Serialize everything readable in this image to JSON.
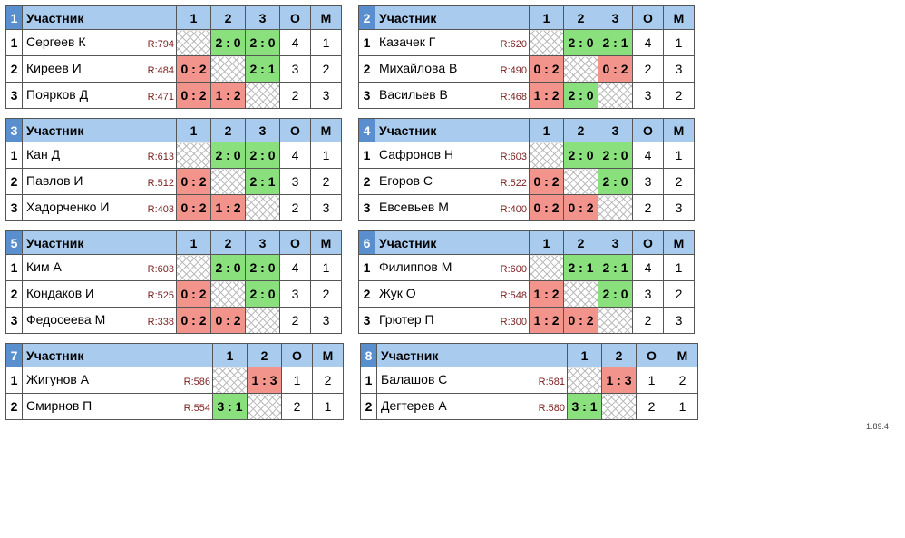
{
  "labels": {
    "participant": "Участник",
    "O": "О",
    "M": "М"
  },
  "footer": "1.89.4",
  "groups": [
    {
      "num": 1,
      "size": 3,
      "players": [
        {
          "n": 1,
          "name": "Сергеев К",
          "rating": "R:794",
          "cells": [
            {
              "t": "diag"
            },
            {
              "t": "win",
              "s": "2 : 0"
            },
            {
              "t": "win",
              "s": "2 : 0"
            }
          ],
          "O": "4",
          "M": "1"
        },
        {
          "n": 2,
          "name": "Киреев И",
          "rating": "R:484",
          "cells": [
            {
              "t": "lose",
              "s": "0 : 2"
            },
            {
              "t": "diag"
            },
            {
              "t": "win",
              "s": "2 : 1"
            }
          ],
          "O": "3",
          "M": "2"
        },
        {
          "n": 3,
          "name": "Поярков Д",
          "rating": "R:471",
          "cells": [
            {
              "t": "lose",
              "s": "0 : 2"
            },
            {
              "t": "lose",
              "s": "1 : 2"
            },
            {
              "t": "diag"
            }
          ],
          "O": "2",
          "M": "3"
        }
      ]
    },
    {
      "num": 2,
      "size": 3,
      "players": [
        {
          "n": 1,
          "name": "Казачек Г",
          "rating": "R:620",
          "cells": [
            {
              "t": "diag"
            },
            {
              "t": "win",
              "s": "2 : 0"
            },
            {
              "t": "win",
              "s": "2 : 1"
            }
          ],
          "O": "4",
          "M": "1"
        },
        {
          "n": 2,
          "name": "Михайлова В",
          "rating": "R:490",
          "cells": [
            {
              "t": "lose",
              "s": "0 : 2"
            },
            {
              "t": "diag"
            },
            {
              "t": "lose",
              "s": "0 : 2"
            }
          ],
          "O": "2",
          "M": "3"
        },
        {
          "n": 3,
          "name": "Васильев В",
          "rating": "R:468",
          "cells": [
            {
              "t": "lose",
              "s": "1 : 2"
            },
            {
              "t": "win",
              "s": "2 : 0"
            },
            {
              "t": "diag"
            }
          ],
          "O": "3",
          "M": "2"
        }
      ]
    },
    {
      "num": 3,
      "size": 3,
      "players": [
        {
          "n": 1,
          "name": "Кан Д",
          "rating": "R:613",
          "cells": [
            {
              "t": "diag"
            },
            {
              "t": "win",
              "s": "2 : 0"
            },
            {
              "t": "win",
              "s": "2 : 0"
            }
          ],
          "O": "4",
          "M": "1"
        },
        {
          "n": 2,
          "name": "Павлов И",
          "rating": "R:512",
          "cells": [
            {
              "t": "lose",
              "s": "0 : 2"
            },
            {
              "t": "diag"
            },
            {
              "t": "win",
              "s": "2 : 1"
            }
          ],
          "O": "3",
          "M": "2"
        },
        {
          "n": 3,
          "name": "Хадорченко И",
          "rating": "R:403",
          "cells": [
            {
              "t": "lose",
              "s": "0 : 2"
            },
            {
              "t": "lose",
              "s": "1 : 2"
            },
            {
              "t": "diag"
            }
          ],
          "O": "2",
          "M": "3"
        }
      ]
    },
    {
      "num": 4,
      "size": 3,
      "players": [
        {
          "n": 1,
          "name": "Сафронов Н",
          "rating": "R:603",
          "cells": [
            {
              "t": "diag"
            },
            {
              "t": "win",
              "s": "2 : 0"
            },
            {
              "t": "win",
              "s": "2 : 0"
            }
          ],
          "O": "4",
          "M": "1"
        },
        {
          "n": 2,
          "name": "Егоров С",
          "rating": "R:522",
          "cells": [
            {
              "t": "lose",
              "s": "0 : 2"
            },
            {
              "t": "diag"
            },
            {
              "t": "win",
              "s": "2 : 0"
            }
          ],
          "O": "3",
          "M": "2"
        },
        {
          "n": 3,
          "name": "Евсевьев М",
          "rating": "R:400",
          "cells": [
            {
              "t": "lose",
              "s": "0 : 2"
            },
            {
              "t": "lose",
              "s": "0 : 2"
            },
            {
              "t": "diag"
            }
          ],
          "O": "2",
          "M": "3"
        }
      ]
    },
    {
      "num": 5,
      "size": 3,
      "players": [
        {
          "n": 1,
          "name": "Ким А",
          "rating": "R:603",
          "cells": [
            {
              "t": "diag"
            },
            {
              "t": "win",
              "s": "2 : 0"
            },
            {
              "t": "win",
              "s": "2 : 0"
            }
          ],
          "O": "4",
          "M": "1"
        },
        {
          "n": 2,
          "name": "Кондаков И",
          "rating": "R:525",
          "cells": [
            {
              "t": "lose",
              "s": "0 : 2"
            },
            {
              "t": "diag"
            },
            {
              "t": "win",
              "s": "2 : 0"
            }
          ],
          "O": "3",
          "M": "2"
        },
        {
          "n": 3,
          "name": "Федосеева М",
          "rating": "R:338",
          "cells": [
            {
              "t": "lose",
              "s": "0 : 2"
            },
            {
              "t": "lose",
              "s": "0 : 2"
            },
            {
              "t": "diag"
            }
          ],
          "O": "2",
          "M": "3"
        }
      ]
    },
    {
      "num": 6,
      "size": 3,
      "players": [
        {
          "n": 1,
          "name": "Филиппов М",
          "rating": "R:600",
          "cells": [
            {
              "t": "diag"
            },
            {
              "t": "win",
              "s": "2 : 1"
            },
            {
              "t": "win",
              "s": "2 : 1"
            }
          ],
          "O": "4",
          "M": "1"
        },
        {
          "n": 2,
          "name": "Жук О",
          "rating": "R:548",
          "cells": [
            {
              "t": "lose",
              "s": "1 : 2"
            },
            {
              "t": "diag"
            },
            {
              "t": "win",
              "s": "2 : 0"
            }
          ],
          "O": "3",
          "M": "2"
        },
        {
          "n": 3,
          "name": "Грютер П",
          "rating": "R:300",
          "cells": [
            {
              "t": "lose",
              "s": "1 : 2"
            },
            {
              "t": "lose",
              "s": "0 : 2"
            },
            {
              "t": "diag"
            }
          ],
          "O": "2",
          "M": "3"
        }
      ]
    },
    {
      "num": 7,
      "size": 2,
      "players": [
        {
          "n": 1,
          "name": "Жигунов А",
          "rating": "R:586",
          "cells": [
            {
              "t": "diag"
            },
            {
              "t": "lose",
              "s": "1 : 3"
            }
          ],
          "O": "1",
          "M": "2"
        },
        {
          "n": 2,
          "name": "Смирнов П",
          "rating": "R:554",
          "cells": [
            {
              "t": "win",
              "s": "3 : 1"
            },
            {
              "t": "diag"
            }
          ],
          "O": "2",
          "M": "1"
        }
      ]
    },
    {
      "num": 8,
      "size": 2,
      "players": [
        {
          "n": 1,
          "name": "Балашов С",
          "rating": "R:581",
          "cells": [
            {
              "t": "diag"
            },
            {
              "t": "lose",
              "s": "1 : 3"
            }
          ],
          "O": "1",
          "M": "2"
        },
        {
          "n": 2,
          "name": "Дегтерев А",
          "rating": "R:580",
          "cells": [
            {
              "t": "win",
              "s": "3 : 1"
            },
            {
              "t": "diag"
            }
          ],
          "O": "2",
          "M": "1"
        }
      ]
    }
  ]
}
